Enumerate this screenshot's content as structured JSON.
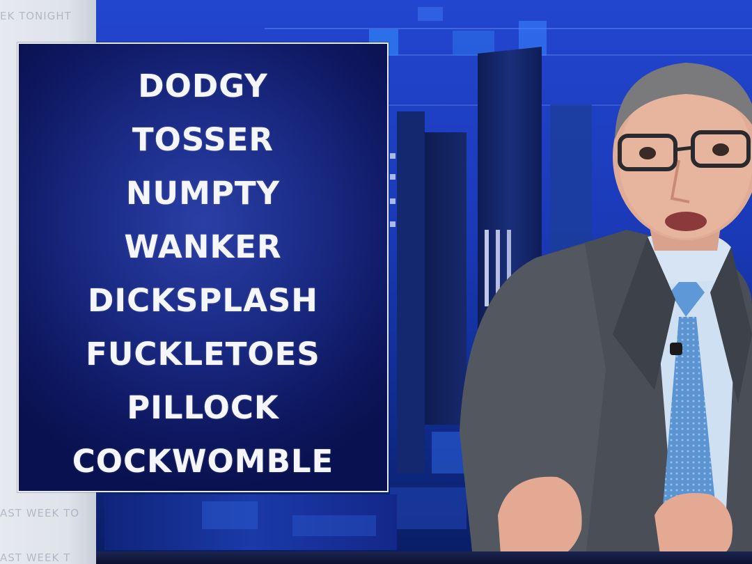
{
  "wall_branding": [
    "EK TONIGHT",
    "AST WEEK TO",
    "AST WEEK T"
  ],
  "panel": {
    "words": [
      "DODGY",
      "TOSSER",
      "NUMPTY",
      "WANKER",
      "DICKSPLASH",
      "FUCKLETOES",
      "PILLOCK",
      "COCKWOMBLE"
    ]
  },
  "colors": {
    "panel_background": "#14207a",
    "panel_text": "#f4f6fb",
    "studio_blue": "#1b3cc0",
    "suit": "#4a4f57",
    "tie": "#5a94d2",
    "shirt": "#cfe0f2"
  }
}
